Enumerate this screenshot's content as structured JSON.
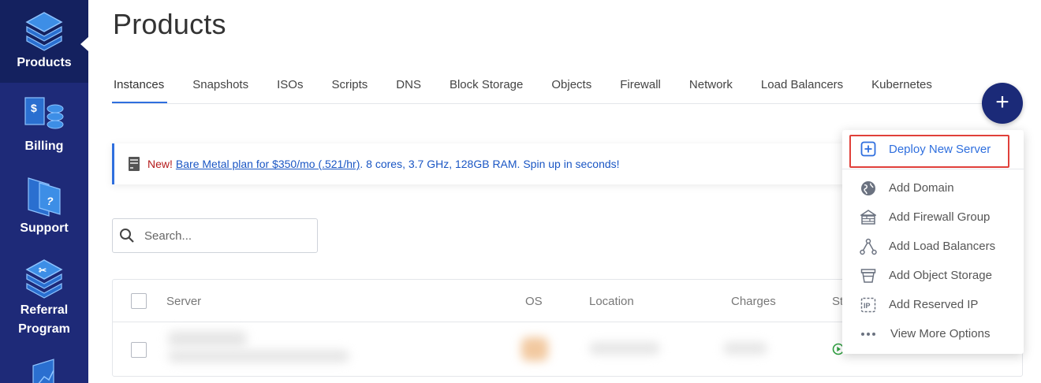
{
  "sidebar": {
    "items": [
      {
        "label": "Products",
        "icon": "layers-icon"
      },
      {
        "label": "Billing",
        "icon": "billing-icon"
      },
      {
        "label": "Support",
        "icon": "support-icon"
      },
      {
        "label": "Referral Program",
        "icon": "referral-icon"
      },
      {
        "label": "",
        "icon": "chart-icon"
      }
    ],
    "bg_color": "#1e2a78"
  },
  "page": {
    "title": "Products"
  },
  "tabs": [
    {
      "label": "Instances",
      "active": true
    },
    {
      "label": "Snapshots"
    },
    {
      "label": "ISOs"
    },
    {
      "label": "Scripts"
    },
    {
      "label": "DNS"
    },
    {
      "label": "Block Storage"
    },
    {
      "label": "Objects"
    },
    {
      "label": "Firewall"
    },
    {
      "label": "Network"
    },
    {
      "label": "Load Balancers"
    },
    {
      "label": "Kubernetes"
    }
  ],
  "fab": {
    "label": "+"
  },
  "banner": {
    "prefix": "New!",
    "link_text": "Bare Metal plan for $350/mo (.521/hr)",
    "rest": ". 8 cores, 3.7 GHz, 128GB RAM. Spin up in seconds!"
  },
  "search": {
    "placeholder": "Search..."
  },
  "table": {
    "columns": [
      "Server",
      "OS",
      "Location",
      "Charges",
      "St"
    ]
  },
  "dropdown": {
    "items": [
      {
        "label": "Deploy New Server",
        "icon": "plus-square-icon"
      },
      {
        "label": "Add Domain",
        "icon": "globe-icon"
      },
      {
        "label": "Add Firewall Group",
        "icon": "firewall-icon"
      },
      {
        "label": "Add Load Balancers",
        "icon": "load-balancer-icon"
      },
      {
        "label": "Add Object Storage",
        "icon": "bucket-icon"
      },
      {
        "label": "Add Reserved IP",
        "icon": "ip-icon"
      },
      {
        "label": "View More Options",
        "icon": "more-dots-icon"
      }
    ]
  },
  "colors": {
    "accent": "#2f6fde",
    "brand": "#1b2a78",
    "alert": "#b51c1c",
    "highlight": "#e0403a"
  }
}
